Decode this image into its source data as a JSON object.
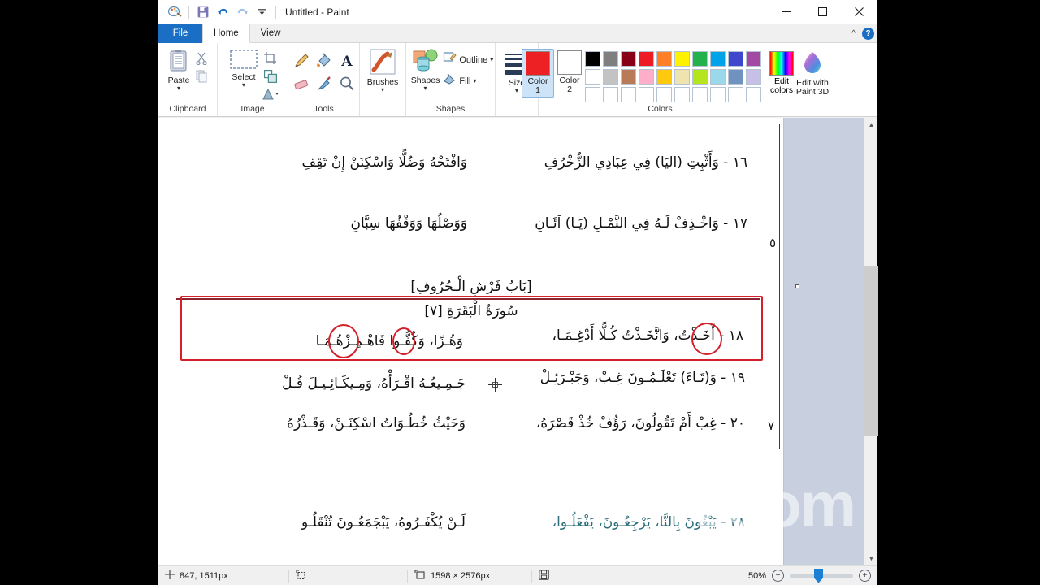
{
  "window": {
    "title": "Untitled - Paint",
    "quick_access": [
      "paint-logo-icon",
      "save-icon",
      "undo-icon",
      "redo-icon",
      "customize-qat-icon"
    ],
    "controls": {
      "minimize": "minimize-icon",
      "maximize": "maximize-icon",
      "close": "close-icon"
    }
  },
  "ribbon": {
    "tabs": [
      {
        "id": "file",
        "label": "File"
      },
      {
        "id": "home",
        "label": "Home"
      },
      {
        "id": "view",
        "label": "View"
      }
    ],
    "active_tab": "Home",
    "collapse_icon": "chevron-up-icon",
    "help_icon": "help-icon",
    "groups": [
      {
        "label": "Clipboard",
        "buttons": [
          {
            "label": "Paste",
            "icon": "paste-icon",
            "has_dropdown": true
          },
          {
            "label": "",
            "icon": "cut-icon",
            "has_dropdown": false
          },
          {
            "label": "",
            "icon": "copy-icon",
            "has_dropdown": false
          }
        ]
      },
      {
        "label": "Image",
        "buttons": [
          {
            "label": "Select",
            "icon": "select-icon",
            "has_dropdown": true
          },
          {
            "label": "",
            "icon": "crop-icon",
            "has_dropdown": false
          },
          {
            "label": "",
            "icon": "resize-icon",
            "has_dropdown": false
          },
          {
            "label": "",
            "icon": "rotate-icon",
            "has_dropdown": true
          }
        ]
      },
      {
        "label": "Tools",
        "buttons": [
          {
            "label": "",
            "icon": "pencil-icon"
          },
          {
            "label": "",
            "icon": "fill-with-color-icon"
          },
          {
            "label": "",
            "icon": "text-tool-icon"
          },
          {
            "label": "",
            "icon": "eraser-icon"
          },
          {
            "label": "",
            "icon": "color-picker-icon"
          },
          {
            "label": "",
            "icon": "magnifier-icon"
          }
        ]
      },
      {
        "label": "",
        "buttons": [
          {
            "label": "Brushes",
            "icon": "brushes-icon",
            "has_dropdown": true
          }
        ]
      },
      {
        "label": "Shapes",
        "buttons": [
          {
            "label": "Shapes",
            "icon": "shapes-icon",
            "has_dropdown": true
          },
          {
            "label": "Outline",
            "icon": "outline-icon",
            "has_dropdown": true
          },
          {
            "label": "Fill",
            "icon": "fill-icon",
            "has_dropdown": true
          }
        ]
      },
      {
        "label": "",
        "buttons": [
          {
            "label": "Size",
            "icon": "size-icon",
            "has_dropdown": true
          }
        ]
      },
      {
        "label": "Colors",
        "color1_label": "Color\n1",
        "color1_label_line1": "Color",
        "color1_label_line2": "1",
        "color2_label_line1": "Color",
        "color2_label_line2": "2",
        "color1_value": "#ED2024",
        "color2_value": "#FFFFFF",
        "edit_colors_label_line1": "Edit",
        "edit_colors_label_line2": "colors",
        "palette_row1": [
          "#000000",
          "#7F7F7F",
          "#880015",
          "#ED1C24",
          "#FF7F27",
          "#FFF200",
          "#22B14C",
          "#00A2E8",
          "#3F48CC",
          "#A349A4"
        ],
        "palette_row2": [
          "#FFFFFF",
          "#C3C3C3",
          "#B97A57",
          "#FFAEC9",
          "#FFC90E",
          "#EFE4B0",
          "#B5E61D",
          "#99D9EA",
          "#7092BE",
          "#C8BFE7"
        ],
        "palette_row3": [
          "",
          "",
          "",
          "",
          "",
          "",
          "",
          "",
          "",
          ""
        ]
      },
      {
        "label": "",
        "buttons": [
          {
            "label_line1": "Edit with",
            "label_line2": "Paint 3D",
            "icon": "paint3d-icon"
          }
        ]
      }
    ]
  },
  "document": {
    "description": "Scanned Arabic tajweed / qira'at poem page opened in Paint, with red annotation box and two red ellipses drawn over line 18",
    "lines": [
      {
        "num": "١٦",
        "right_col": "١٦ - وَأَثْبِتِ (اليَا) فِي عِبَادِي الزُّخْرُفِ",
        "left_col": "وَافْتَحْهُ وَضُلًّا وَاسْكِنَنْ إِنْ تَقِفِ"
      },
      {
        "num": "١٧",
        "right_col": "١٧ - وَاخْـذِفْ لَـهُ فِي النَّمْـلِ (يَـا) آئَـانِ",
        "left_col": "وَوَصْلُهَا وَوَقْفُهَا سِبَّانِ"
      },
      {
        "num": "١٨",
        "right_col": "١٨ - أَخَـذْتُ، وَانَّخَـذْتُ كُـلًّا أَدْغِـمَـا،",
        "left_col": "وَهُـزًا، وَكُفُّـوا فَاهْـمِـزْهُـمَـا"
      },
      {
        "num": "١٩",
        "right_col": "١٩ - وَ(تَـاءَ) تَعْلَـمُـونَ غِـبْ، وَجَبْـرَئِـلْ",
        "left_col": "جَـمِـيعُـهُ اقْـرَأْهُ، وَمِـيكَـائِـيـلَ قُـلْ"
      },
      {
        "num": "٢٠",
        "right_col": "٢٠ - غِبْ أَمْ تَقُولُونَ، رَؤُفْ خُذْ قَصْرَهُ،",
        "left_col": "وَحَيْثُ خُطُـوَاتُ اسْكِنَـنْ، وَقَـذْرُهُ"
      },
      {
        "num": "٢٨",
        "right_col": "٢٨ - يَبْغُونَ بِالنَّا، يَرْجِعُـونَ، يَفْعَلُـوا،",
        "left_col": "لَـنْ يُكْفَـرُوهُ، يَبْجَمَعُـونَ تُنْقَلُـو"
      }
    ],
    "headings": [
      {
        "text": "[بَابُ فَرْشِ الْـحُرُوفِ]"
      },
      {
        "text": "سُورَةُ الْبَقَرَةِ [٧]"
      }
    ],
    "margin_marks": [
      "٥",
      "٧"
    ]
  },
  "annotations": {
    "box_color": "#D4202A",
    "ellipse_color": "#D4202A"
  },
  "statusbar": {
    "cursor_icon": "cursor-position-icon",
    "cursor_position": "847, 1511px",
    "selection_icon": "selection-size-icon",
    "selection_size": "",
    "image_icon": "image-size-icon",
    "image_size": "1598 × 2576px",
    "file_size_icon": "file-size-icon",
    "file_size": "",
    "zoom_level": "50%",
    "zoom_out_icon": "zoom-out-icon",
    "zoom_in_icon": "zoom-in-icon"
  },
  "overlay": {
    "watermark": "zoom"
  },
  "scrollbar": {
    "up_icon": "scroll-up-icon",
    "down_icon": "scroll-down-icon"
  }
}
